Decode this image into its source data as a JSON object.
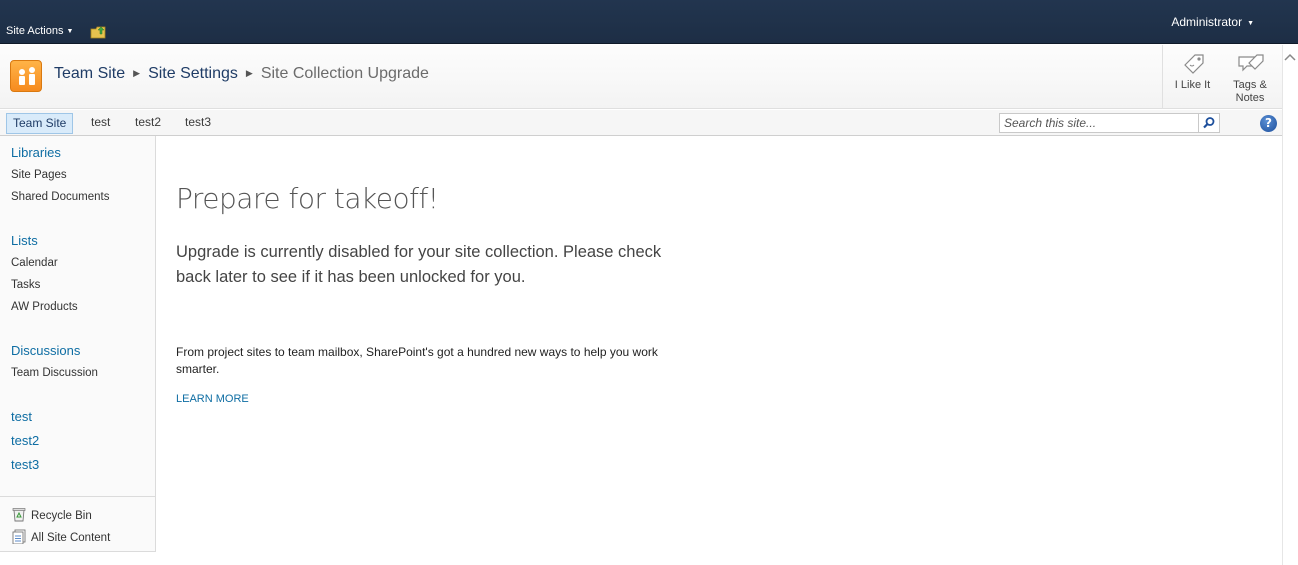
{
  "topbar": {
    "site_actions_label": "Site Actions",
    "user_label": "Administrator"
  },
  "breadcrumb": {
    "items": [
      "Team Site",
      "Site Settings",
      "Site Collection Upgrade"
    ]
  },
  "social": {
    "like_label": "I Like It",
    "tags_label_line1": "Tags &",
    "tags_label_line2": "Notes"
  },
  "topnav": {
    "items": [
      "Team Site",
      "test",
      "test2",
      "test3"
    ],
    "search_placeholder": "Search this site...",
    "help_label": "?"
  },
  "leftnav": {
    "libraries": {
      "heading": "Libraries",
      "items": [
        "Site Pages",
        "Shared Documents"
      ]
    },
    "lists": {
      "heading": "Lists",
      "items": [
        "Calendar",
        "Tasks",
        "AW Products"
      ]
    },
    "discussions": {
      "heading": "Discussions",
      "items": [
        "Team Discussion"
      ]
    },
    "sites": [
      "test",
      "test2",
      "test3"
    ],
    "recycle_bin": "Recycle Bin",
    "all_site_content": "All Site Content"
  },
  "main": {
    "headline": "Prepare for takeoff!",
    "lead": "Upgrade is currently disabled for your site collection. Please check back later to see if it has been unlocked for you.",
    "sub": "From project sites to team mailbox, SharePoint's got a hundred new ways to help you work smarter.",
    "learn_more": "LEARN MORE"
  },
  "colors": {
    "topbar": "#22354f",
    "link": "#0e6da3",
    "breadcrumb_link": "#1f3c66",
    "logo": "#f68b1f"
  },
  "icons": [
    "folder-up-icon",
    "site-logo-icon",
    "like-tag-icon",
    "tags-notes-icon",
    "search-icon",
    "help-icon",
    "recycle-bin-icon",
    "all-content-icon",
    "scroll-up-icon"
  ]
}
